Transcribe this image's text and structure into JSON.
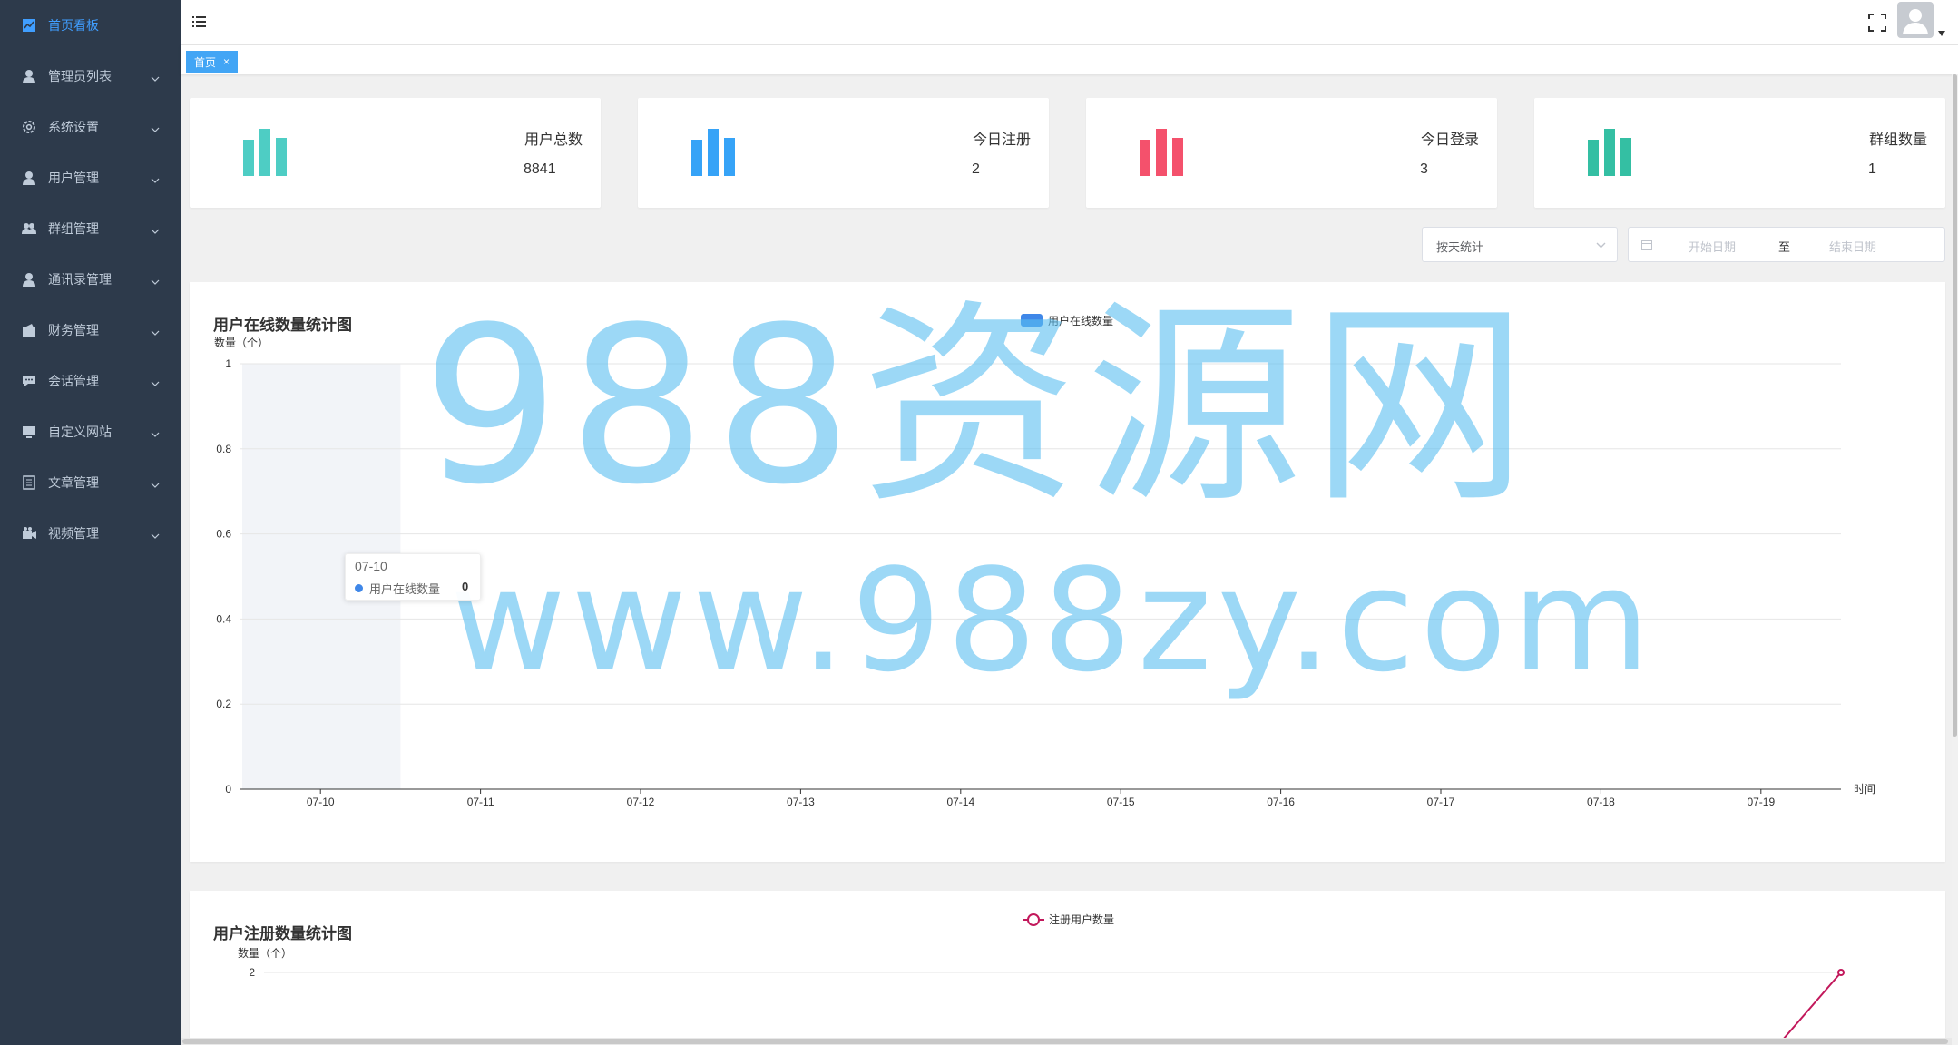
{
  "sidebar": {
    "items": [
      {
        "label": "首页看板",
        "icon": "dashboard-icon",
        "active": true
      },
      {
        "label": "管理员列表",
        "icon": "user-icon"
      },
      {
        "label": "系统设置",
        "icon": "gear-icon"
      },
      {
        "label": "用户管理",
        "icon": "user-icon"
      },
      {
        "label": "群组管理",
        "icon": "group-icon"
      },
      {
        "label": "通讯录管理",
        "icon": "user-icon"
      },
      {
        "label": "财务管理",
        "icon": "wallet-icon"
      },
      {
        "label": "会话管理",
        "icon": "chat-icon"
      },
      {
        "label": "自定义网站",
        "icon": "monitor-icon"
      },
      {
        "label": "文章管理",
        "icon": "document-icon"
      },
      {
        "label": "视频管理",
        "icon": "video-icon"
      }
    ]
  },
  "header": {
    "menu_icon": "hamburger-icon",
    "fullscreen_icon": "fullscreen-icon",
    "avatar_icon": "avatar-icon"
  },
  "tags": [
    {
      "label": "首页",
      "close": "×"
    }
  ],
  "stats": [
    {
      "title": "用户总数",
      "value": "8841",
      "color": "#4ecdc4"
    },
    {
      "title": "今日注册",
      "value": "2",
      "color": "#36a3f7"
    },
    {
      "title": "今日登录",
      "value": "3",
      "color": "#f4516c"
    },
    {
      "title": "群组数量",
      "value": "1",
      "color": "#34bfa3"
    }
  ],
  "filters": {
    "mode_value": "按天统计",
    "start_placeholder": "开始日期",
    "range_separator": "至",
    "end_placeholder": "结束日期"
  },
  "watermark": {
    "line1": "988资源网",
    "line2": "www.988zy.com"
  },
  "chart_data": [
    {
      "type": "bar",
      "title": "用户在线数量统计图",
      "ylabel": "数量（个）",
      "xlabel": "时间",
      "ylim": [
        0,
        1
      ],
      "yticks": [
        0,
        0.2,
        0.4,
        0.6,
        0.8,
        1
      ],
      "categories": [
        "07-10",
        "07-11",
        "07-12",
        "07-13",
        "07-14",
        "07-15",
        "07-16",
        "07-17",
        "07-18",
        "07-19"
      ],
      "series": [
        {
          "name": "用户在线数量",
          "values": [
            0,
            0,
            0,
            0,
            0,
            0,
            0,
            0,
            0,
            0
          ],
          "color": "#3f87e8"
        }
      ],
      "legend": "top-center",
      "grid": true,
      "tooltip": {
        "category": "07-10",
        "series": "用户在线数量",
        "value": "0"
      }
    },
    {
      "type": "line",
      "title": "用户注册数量统计图",
      "ylabel": "数量（个）",
      "series": [
        {
          "name": "注册用户数量",
          "color": "#c2185b"
        }
      ],
      "legend": "top-center",
      "yticks_visible": [
        2
      ],
      "grid": true
    }
  ]
}
